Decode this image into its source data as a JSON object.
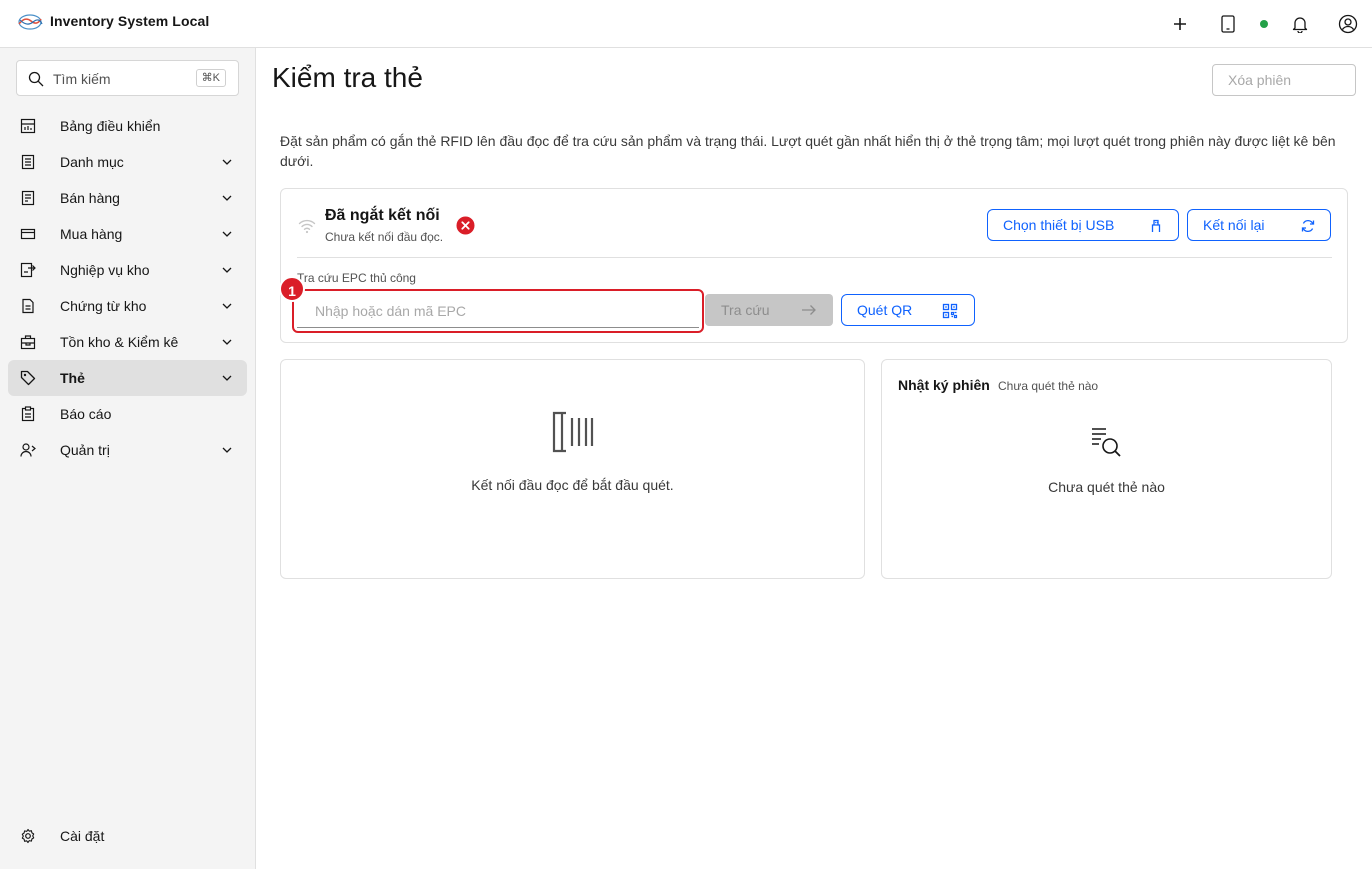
{
  "app": {
    "title": "Inventory System Local"
  },
  "topbar": {
    "status_color": "#24a148"
  },
  "sidebar": {
    "search": {
      "placeholder": "Tìm kiếm",
      "shortcut": "⌘K"
    },
    "items": [
      {
        "label": "Bảng điều khiển",
        "icon": "dashboard-icon",
        "has_children": false,
        "active": false
      },
      {
        "label": "Danh mục",
        "icon": "catalog-icon",
        "has_children": true,
        "active": false
      },
      {
        "label": "Bán hàng",
        "icon": "sales-icon",
        "has_children": true,
        "active": false
      },
      {
        "label": "Mua hàng",
        "icon": "purchase-icon",
        "has_children": true,
        "active": false
      },
      {
        "label": "Nghiệp vụ kho",
        "icon": "warehouse-ops-icon",
        "has_children": true,
        "active": false
      },
      {
        "label": "Chứng từ kho",
        "icon": "document-icon",
        "has_children": true,
        "active": false
      },
      {
        "label": "Tồn kho & Kiểm kê",
        "icon": "inventory-icon",
        "has_children": true,
        "active": false
      },
      {
        "label": "Thẻ",
        "icon": "tag-icon",
        "has_children": true,
        "active": true
      },
      {
        "label": "Báo cáo",
        "icon": "report-icon",
        "has_children": false,
        "active": false
      },
      {
        "label": "Quản trị",
        "icon": "admin-icon",
        "has_children": true,
        "active": false
      }
    ],
    "settings_label": "Cài đặt"
  },
  "main": {
    "title": "Kiểm tra thẻ",
    "clear_session_label": "Xóa phiên",
    "description": "Đặt sản phẩm có gắn thẻ RFID lên đầu đọc để tra cứu sản phẩm và trạng thái. Lượt quét gần nhất hiển thị ở thẻ trọng tâm; mọi lượt quét trong phiên này được liệt kê bên dưới.",
    "reader": {
      "status_title": "Đã ngắt kết nối",
      "status_subtitle": "Chưa kết nối đầu đọc.",
      "choose_usb_label": "Chọn thiết bị USB",
      "reconnect_label": "Kết nối lại",
      "error_color": "#da1e28"
    },
    "epc": {
      "label": "Tra cứu EPC thủ công",
      "placeholder": "Nhập hoặc dán mã EPC",
      "lookup_label": "Tra cứu",
      "qr_label": "Quét QR",
      "annotation_number": "1"
    },
    "scan_panel": {
      "empty_text": "Kết nối đầu đọc để bắt đầu quét."
    },
    "log_panel": {
      "title": "Nhật ký phiên",
      "subtitle": "Chưa quét thẻ nào",
      "empty_text": "Chưa quét thẻ nào"
    }
  },
  "colors": {
    "accent": "#0f62fe",
    "error": "#da1e28",
    "status_ok": "#24a148"
  }
}
